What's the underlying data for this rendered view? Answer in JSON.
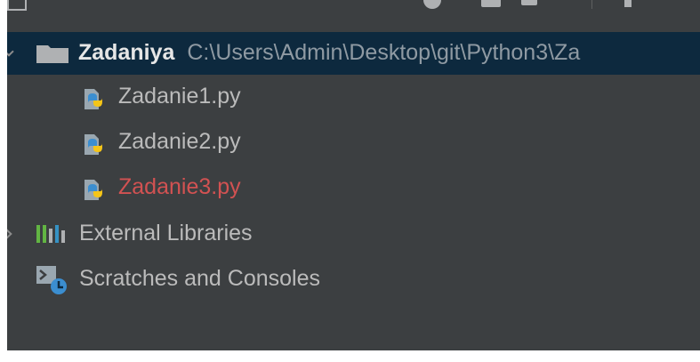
{
  "project_tree": {
    "root": {
      "name": "Zadaniya",
      "path": "C:\\Users\\Admin\\Desktop\\git\\Python3\\Za"
    },
    "files": [
      {
        "name": "Zadanie1.py",
        "has_error": false,
        "icon": "python-file-icon"
      },
      {
        "name": "Zadanie2.py",
        "has_error": false,
        "icon": "python-file-icon"
      },
      {
        "name": "Zadanie3.py",
        "has_error": true,
        "icon": "python-file-icon"
      }
    ],
    "external_libraries": {
      "label": "External Libraries",
      "icon": "libraries-icon"
    },
    "scratches": {
      "label": "Scratches and Consoles",
      "icon": "scratches-icon"
    }
  },
  "colors": {
    "panel_bg": "#3c3f41",
    "selection_bg": "#0d293e",
    "text": "#bbbbbb",
    "error_text": "#d25252",
    "path_text": "#8f9aa3"
  }
}
